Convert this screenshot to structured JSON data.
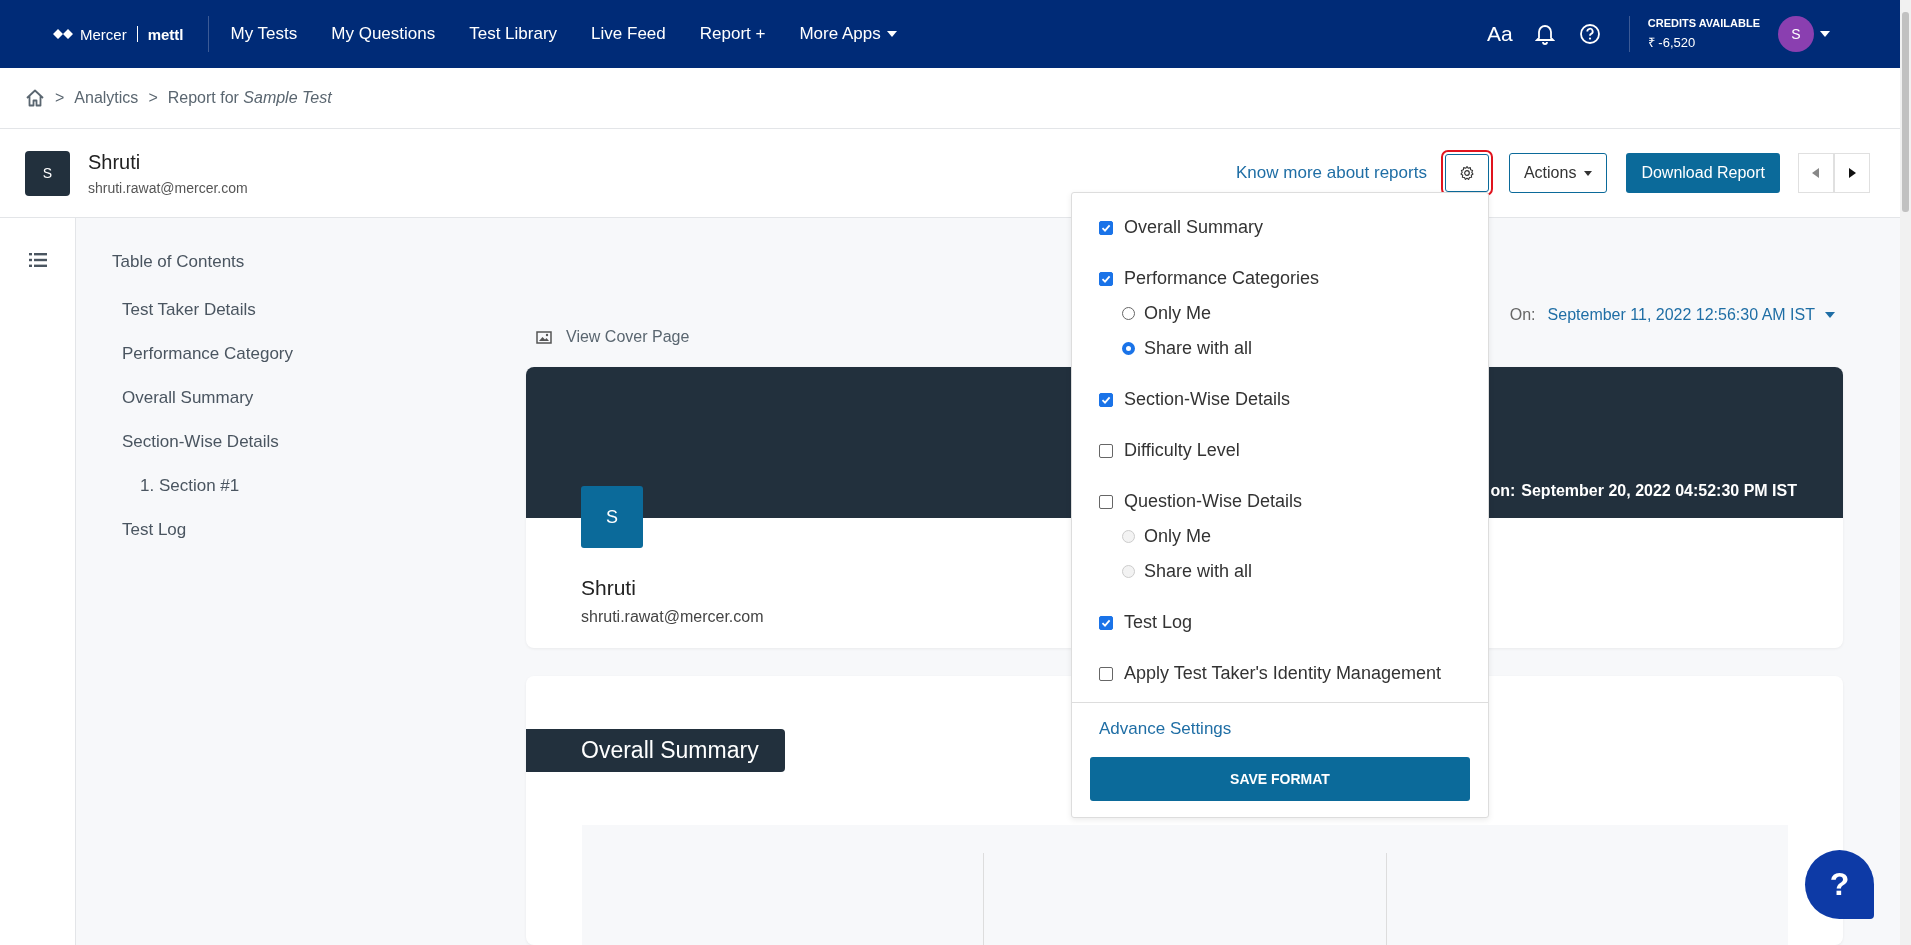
{
  "nav": {
    "logo": {
      "brand": "Mercer",
      "product": "mettl"
    },
    "items": [
      {
        "label": "My Tests",
        "dropdown": false
      },
      {
        "label": "My Questions",
        "dropdown": false
      },
      {
        "label": "Test Library",
        "dropdown": false
      },
      {
        "label": "Live Feed",
        "dropdown": false
      },
      {
        "label": "Report +",
        "dropdown": false
      },
      {
        "label": "More Apps",
        "dropdown": true
      }
    ],
    "font_button": "Aa",
    "credits": {
      "label": "CREDITS AVAILABLE",
      "value": "₹ -6,520"
    },
    "avatar": "S"
  },
  "breadcrumb": [
    {
      "separator": ">",
      "label": "Analytics"
    },
    {
      "separator": ">",
      "label": "Report for *Sample Test*"
    }
  ],
  "candidate": {
    "avatar": "S",
    "name": "Shruti",
    "email": "shruti.rawat@mercer.com"
  },
  "header_actions": {
    "link": "Know more about reports",
    "actions": "Actions",
    "download": "Download Report"
  },
  "toc": {
    "title": "Table of Contents",
    "items": [
      {
        "label": "Test Taker Details"
      },
      {
        "label": "Performance Category"
      },
      {
        "label": "Overall Summary"
      },
      {
        "label": "Section-Wise Details",
        "children": [
          {
            "label": "1. Section #1"
          }
        ]
      },
      {
        "label": "Test Log"
      }
    ]
  },
  "report": {
    "attempt_label": "On:",
    "attempt_date": "September 11, 2022 12:56:30 AM IST",
    "view_cover": "View Cover Page",
    "cover": {
      "date_label": "on:",
      "date": "September 20, 2022 04:52:30 PM IST",
      "avatar": "S",
      "name": "Shruti",
      "email": "shruti.rawat@mercer.com"
    },
    "section_title": "Overall Summary"
  },
  "report_settings": {
    "items": [
      {
        "label": "Overall Summary",
        "checked": true
      },
      {
        "label": "Performance Categories",
        "checked": true,
        "options": [
          {
            "label": "Only Me",
            "selected": false,
            "disabled": false
          },
          {
            "label": "Share with all",
            "selected": true,
            "disabled": false
          }
        ]
      },
      {
        "label": "Section-Wise Details",
        "checked": true
      },
      {
        "label": "Difficulty Level",
        "checked": false
      },
      {
        "label": "Question-Wise Details",
        "checked": false,
        "options": [
          {
            "label": "Only Me",
            "selected": false,
            "disabled": true
          },
          {
            "label": "Share with all",
            "selected": false,
            "disabled": true
          }
        ]
      },
      {
        "label": "Test Log",
        "checked": true
      },
      {
        "label": "Apply Test Taker's Identity Management",
        "checked": false
      }
    ],
    "link": "Advance Settings",
    "button": "SAVE FORMAT"
  },
  "help_button": "?"
}
